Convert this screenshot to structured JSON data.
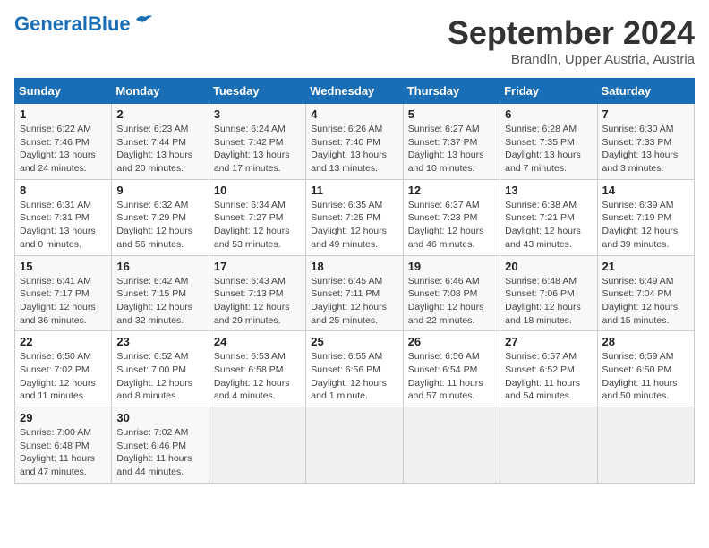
{
  "header": {
    "logo_line1": "General",
    "logo_line2": "Blue",
    "month": "September 2024",
    "location": "Brandln, Upper Austria, Austria"
  },
  "weekdays": [
    "Sunday",
    "Monday",
    "Tuesday",
    "Wednesday",
    "Thursday",
    "Friday",
    "Saturday"
  ],
  "weeks": [
    [
      {
        "day": "1",
        "info": "Sunrise: 6:22 AM\nSunset: 7:46 PM\nDaylight: 13 hours\nand 24 minutes."
      },
      {
        "day": "2",
        "info": "Sunrise: 6:23 AM\nSunset: 7:44 PM\nDaylight: 13 hours\nand 20 minutes."
      },
      {
        "day": "3",
        "info": "Sunrise: 6:24 AM\nSunset: 7:42 PM\nDaylight: 13 hours\nand 17 minutes."
      },
      {
        "day": "4",
        "info": "Sunrise: 6:26 AM\nSunset: 7:40 PM\nDaylight: 13 hours\nand 13 minutes."
      },
      {
        "day": "5",
        "info": "Sunrise: 6:27 AM\nSunset: 7:37 PM\nDaylight: 13 hours\nand 10 minutes."
      },
      {
        "day": "6",
        "info": "Sunrise: 6:28 AM\nSunset: 7:35 PM\nDaylight: 13 hours\nand 7 minutes."
      },
      {
        "day": "7",
        "info": "Sunrise: 6:30 AM\nSunset: 7:33 PM\nDaylight: 13 hours\nand 3 minutes."
      }
    ],
    [
      {
        "day": "8",
        "info": "Sunrise: 6:31 AM\nSunset: 7:31 PM\nDaylight: 13 hours\nand 0 minutes."
      },
      {
        "day": "9",
        "info": "Sunrise: 6:32 AM\nSunset: 7:29 PM\nDaylight: 12 hours\nand 56 minutes."
      },
      {
        "day": "10",
        "info": "Sunrise: 6:34 AM\nSunset: 7:27 PM\nDaylight: 12 hours\nand 53 minutes."
      },
      {
        "day": "11",
        "info": "Sunrise: 6:35 AM\nSunset: 7:25 PM\nDaylight: 12 hours\nand 49 minutes."
      },
      {
        "day": "12",
        "info": "Sunrise: 6:37 AM\nSunset: 7:23 PM\nDaylight: 12 hours\nand 46 minutes."
      },
      {
        "day": "13",
        "info": "Sunrise: 6:38 AM\nSunset: 7:21 PM\nDaylight: 12 hours\nand 43 minutes."
      },
      {
        "day": "14",
        "info": "Sunrise: 6:39 AM\nSunset: 7:19 PM\nDaylight: 12 hours\nand 39 minutes."
      }
    ],
    [
      {
        "day": "15",
        "info": "Sunrise: 6:41 AM\nSunset: 7:17 PM\nDaylight: 12 hours\nand 36 minutes."
      },
      {
        "day": "16",
        "info": "Sunrise: 6:42 AM\nSunset: 7:15 PM\nDaylight: 12 hours\nand 32 minutes."
      },
      {
        "day": "17",
        "info": "Sunrise: 6:43 AM\nSunset: 7:13 PM\nDaylight: 12 hours\nand 29 minutes."
      },
      {
        "day": "18",
        "info": "Sunrise: 6:45 AM\nSunset: 7:11 PM\nDaylight: 12 hours\nand 25 minutes."
      },
      {
        "day": "19",
        "info": "Sunrise: 6:46 AM\nSunset: 7:08 PM\nDaylight: 12 hours\nand 22 minutes."
      },
      {
        "day": "20",
        "info": "Sunrise: 6:48 AM\nSunset: 7:06 PM\nDaylight: 12 hours\nand 18 minutes."
      },
      {
        "day": "21",
        "info": "Sunrise: 6:49 AM\nSunset: 7:04 PM\nDaylight: 12 hours\nand 15 minutes."
      }
    ],
    [
      {
        "day": "22",
        "info": "Sunrise: 6:50 AM\nSunset: 7:02 PM\nDaylight: 12 hours\nand 11 minutes."
      },
      {
        "day": "23",
        "info": "Sunrise: 6:52 AM\nSunset: 7:00 PM\nDaylight: 12 hours\nand 8 minutes."
      },
      {
        "day": "24",
        "info": "Sunrise: 6:53 AM\nSunset: 6:58 PM\nDaylight: 12 hours\nand 4 minutes."
      },
      {
        "day": "25",
        "info": "Sunrise: 6:55 AM\nSunset: 6:56 PM\nDaylight: 12 hours\nand 1 minute."
      },
      {
        "day": "26",
        "info": "Sunrise: 6:56 AM\nSunset: 6:54 PM\nDaylight: 11 hours\nand 57 minutes."
      },
      {
        "day": "27",
        "info": "Sunrise: 6:57 AM\nSunset: 6:52 PM\nDaylight: 11 hours\nand 54 minutes."
      },
      {
        "day": "28",
        "info": "Sunrise: 6:59 AM\nSunset: 6:50 PM\nDaylight: 11 hours\nand 50 minutes."
      }
    ],
    [
      {
        "day": "29",
        "info": "Sunrise: 7:00 AM\nSunset: 6:48 PM\nDaylight: 11 hours\nand 47 minutes."
      },
      {
        "day": "30",
        "info": "Sunrise: 7:02 AM\nSunset: 6:46 PM\nDaylight: 11 hours\nand 44 minutes."
      },
      {
        "day": "",
        "info": ""
      },
      {
        "day": "",
        "info": ""
      },
      {
        "day": "",
        "info": ""
      },
      {
        "day": "",
        "info": ""
      },
      {
        "day": "",
        "info": ""
      }
    ]
  ]
}
